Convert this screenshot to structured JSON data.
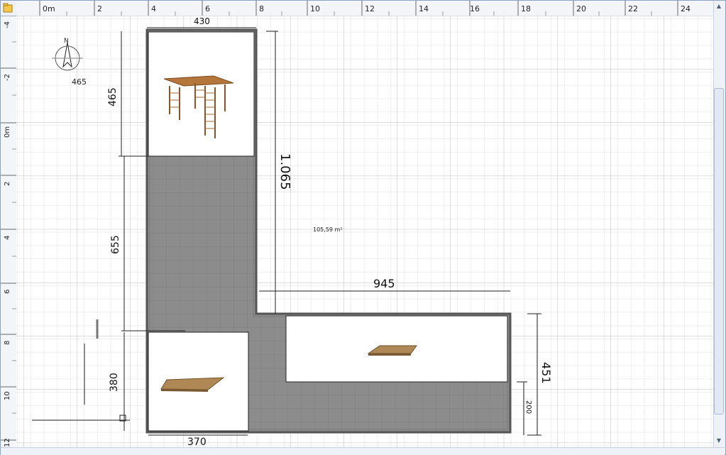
{
  "rulers": {
    "horizontal": [
      "0m",
      "2",
      "4",
      "6",
      "8",
      "10",
      "12",
      "14",
      "16",
      "18",
      "20",
      "22",
      "24"
    ],
    "vertical": [
      "-4",
      "-2",
      "0m",
      "2",
      "4",
      "6",
      "8",
      "10",
      "12"
    ]
  },
  "compass": {
    "label": "N",
    "value": "465"
  },
  "dimensions": {
    "top_width": "430",
    "left_upper": "465",
    "right_long": "1.065",
    "left_middle": "655",
    "bottom_arm": "945",
    "left_lower": "380",
    "bottom_width": "370",
    "right_outer": "451",
    "right_inner": "200"
  },
  "room": {
    "area": "105,59 m²"
  },
  "furniture": [
    {
      "name": "pergola-model"
    },
    {
      "name": "wooden-deck-small"
    },
    {
      "name": "wooden-deck-large"
    }
  ],
  "colors": {
    "floor": "#8c8c8c",
    "grid": "#c8c8c8",
    "wall": "#555555",
    "ruler_bg": "#f3f5f9"
  }
}
